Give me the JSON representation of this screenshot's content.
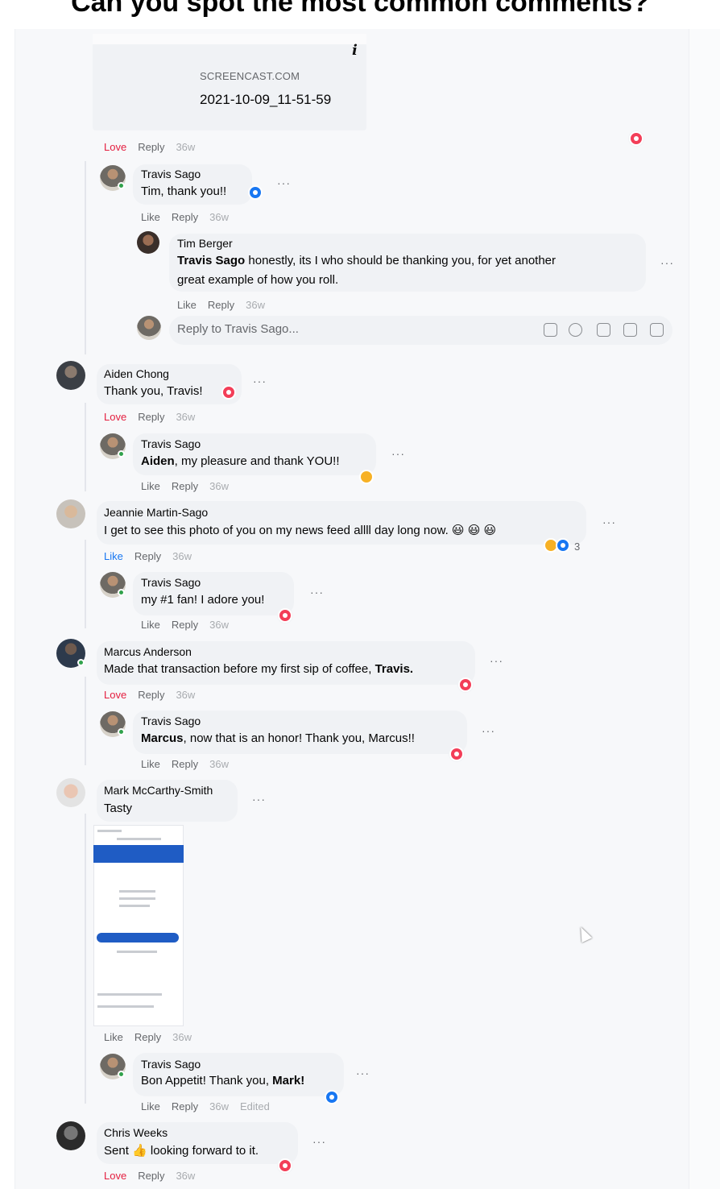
{
  "header": {
    "title": "Can you spot the most common comments?"
  },
  "link_card": {
    "domain": "SCREENCAST.COM",
    "title": "2021-10-09_11-51-59",
    "info": "i"
  },
  "top_actions": {
    "love": "Love",
    "reply": "Reply",
    "time": "36w"
  },
  "comments": [
    {
      "name": "Travis Sago",
      "text": "Tim, thank you!!",
      "like": "Like",
      "reply": "Reply",
      "time": "36w",
      "reaction": "thumb"
    },
    {
      "name": "Tim Berger",
      "mention": "Travis Sago",
      "text_line1": " honestly, its I who should be thanking you, for yet another",
      "text_line2": "great example of how you roll.",
      "like": "Like",
      "reply": "Reply",
      "time": "36w"
    },
    {
      "name": "Aiden Chong",
      "text": "Thank you, Travis!",
      "love": "Love",
      "reply": "Reply",
      "time": "36w",
      "reaction": "heart"
    },
    {
      "name": "Travis Sago",
      "mention": "Aiden",
      "text": ", my pleasure and thank YOU!!",
      "like": "Like",
      "reply": "Reply",
      "time": "36w",
      "reaction": "haha"
    },
    {
      "name": "Jeannie Martin-Sago",
      "text": "I get to see this photo of you on my news feed allll day long now. 😃 😃 😃",
      "like": "Like",
      "reply": "Reply",
      "time": "36w",
      "reaction_count": "3"
    },
    {
      "name": "Travis Sago",
      "text": "my #1 fan! I adore you!",
      "like": "Like",
      "reply": "Reply",
      "time": "36w",
      "reaction": "heart"
    },
    {
      "name": "Marcus Anderson",
      "text": "Made that transaction before my first sip of coffee, ",
      "mention": "Travis.",
      "love": "Love",
      "reply": "Reply",
      "time": "36w",
      "reaction": "heart"
    },
    {
      "name": "Travis Sago",
      "mention": "Marcus",
      "text": ", now that is an honor! Thank you, Marcus!!",
      "like": "Like",
      "reply": "Reply",
      "time": "36w",
      "reaction": "heart"
    },
    {
      "name": "Mark McCarthy-Smith",
      "text": "Tasty",
      "like": "Like",
      "reply": "Reply",
      "time": "36w"
    },
    {
      "name": "Travis Sago",
      "text": "Bon Appetit! Thank you, ",
      "mention": "Mark!",
      "like": "Like",
      "reply": "Reply",
      "time": "36w",
      "edited": "Edited",
      "reaction": "thumb"
    },
    {
      "name": "Chris Weeks",
      "text": "Sent 👍 looking forward to it.",
      "love": "Love",
      "reply": "Reply",
      "time": "36w",
      "reaction": "heart"
    }
  ],
  "reply_box": {
    "placeholder": "Reply to Travis Sago..."
  },
  "more_label": "···"
}
